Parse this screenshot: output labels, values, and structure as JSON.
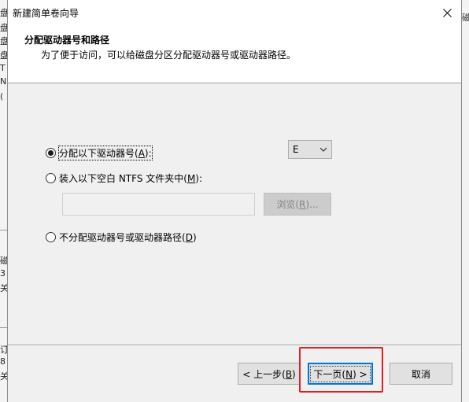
{
  "window": {
    "title": "新建简单卷向导",
    "header_title": "分配驱动器号和路径",
    "header_subtitle": "为了便于访问，可以给磁盘分区分配驱动器号或驱动器路径。"
  },
  "options": {
    "assign_letter": {
      "label": "分配以下驱动器号",
      "mnemonic": "A",
      "suffix": ":",
      "selected": true
    },
    "mount_folder": {
      "label": "装入以下空白 NTFS 文件夹中",
      "mnemonic": "M",
      "suffix": ":",
      "selected": false
    },
    "no_assign": {
      "label": "不分配驱动器号或驱动器路径",
      "mnemonic": "D",
      "suffix": "",
      "selected": false
    }
  },
  "drive_letter": {
    "value": "E"
  },
  "folder_path": {
    "value": ""
  },
  "browse_button": {
    "label": "浏览",
    "mnemonic": "R",
    "suffix": "..."
  },
  "footer": {
    "back": {
      "prefix": "< 上一步",
      "mnemonic": "B"
    },
    "next": {
      "prefix": "下一页",
      "mnemonic": "N",
      "suffix": " >"
    },
    "cancel": {
      "label": "取消"
    }
  },
  "background": {
    "left_fragments": [
      "盘",
      "盘",
      "盘",
      "盘",
      "T",
      "N",
      "(",
      "磁",
      "3",
      "关",
      "订",
      "8",
      "关"
    ],
    "right_fragments": [
      "磁"
    ]
  },
  "colors": {
    "highlight": "#e02020",
    "focus_border": "#0078d7"
  }
}
